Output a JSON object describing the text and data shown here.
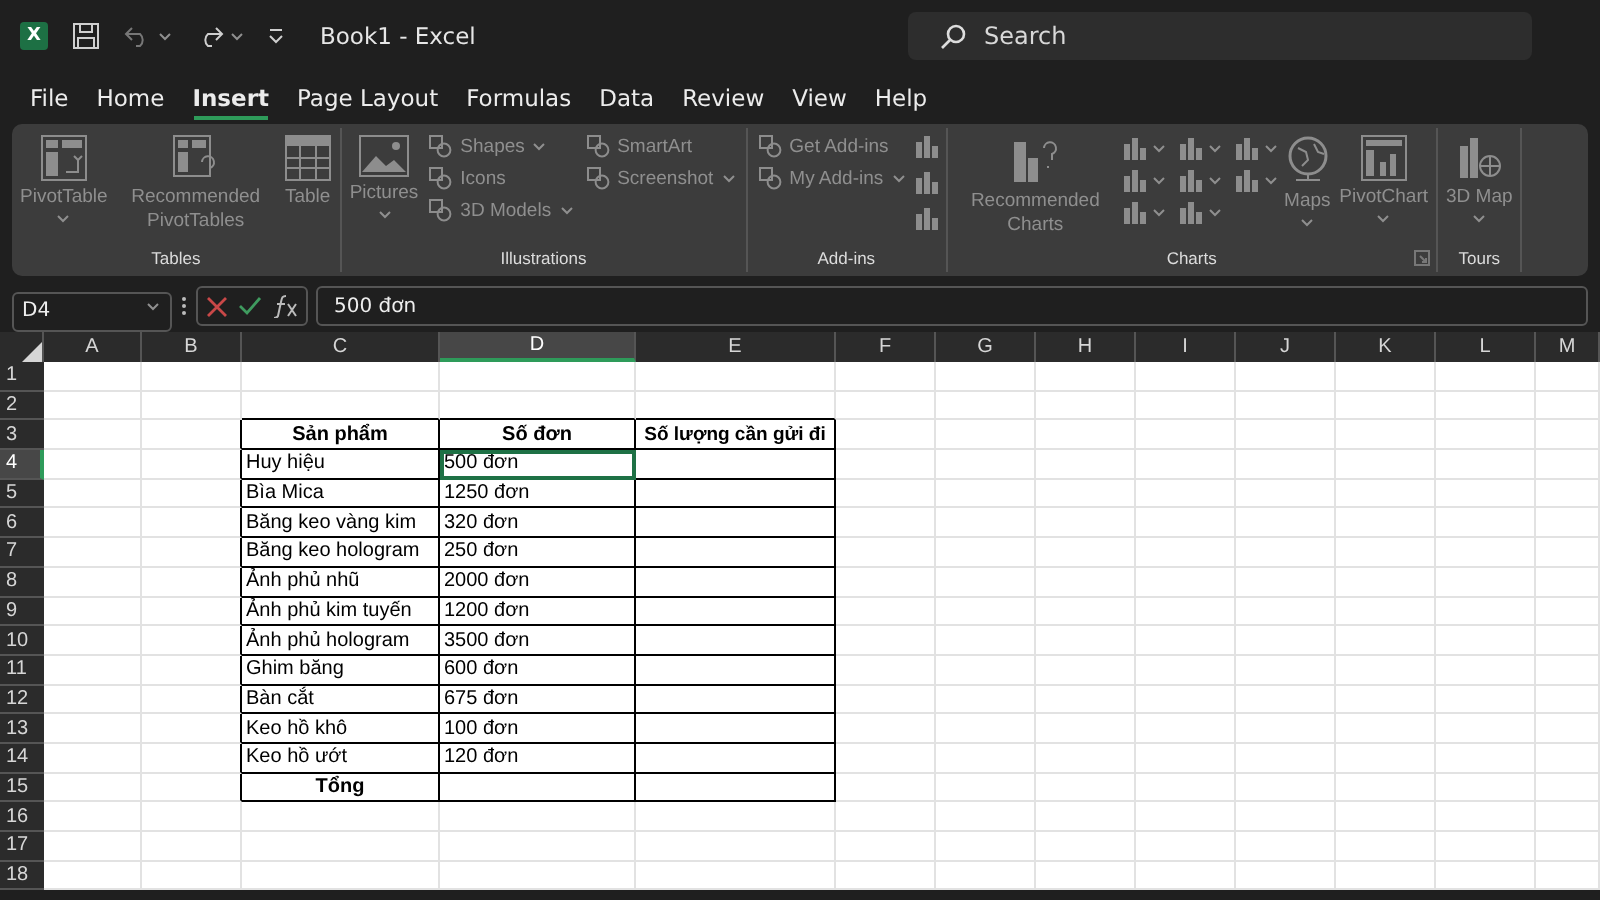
{
  "title_bar": {
    "logo_letter": "X",
    "title": "Book1  -  Excel",
    "search": {
      "placeholder": "Search"
    }
  },
  "menu_tabs": [
    {
      "label": "File",
      "selected": false
    },
    {
      "label": "Home",
      "selected": false
    },
    {
      "label": "Insert",
      "selected": true
    },
    {
      "label": "Page Layout",
      "selected": false
    },
    {
      "label": "Formulas",
      "selected": false
    },
    {
      "label": "Data",
      "selected": false
    },
    {
      "label": "Review",
      "selected": false
    },
    {
      "label": "View",
      "selected": false
    },
    {
      "label": "Help",
      "selected": false
    }
  ],
  "ribbon": {
    "groups": [
      {
        "label": "Tables",
        "items": [
          {
            "kind": "large",
            "label": "PivotTable",
            "dropdown": true
          },
          {
            "kind": "large",
            "label": "Recommended PivotTables",
            "dropdown": false
          },
          {
            "kind": "large",
            "label": "Table",
            "dropdown": false
          }
        ]
      },
      {
        "label": "Illustrations",
        "items": [
          {
            "kind": "large",
            "label": "Pictures",
            "dropdown": true
          },
          {
            "kind": "stack",
            "items": [
              {
                "label": "Shapes",
                "dropdown": true
              },
              {
                "label": "Icons",
                "dropdown": false
              },
              {
                "label": "3D Models",
                "dropdown": true
              }
            ]
          },
          {
            "kind": "stack",
            "items": [
              {
                "label": "SmartArt",
                "dropdown": false
              },
              {
                "label": "Screenshot",
                "dropdown": true
              }
            ]
          }
        ]
      },
      {
        "label": "Add-ins",
        "items": [
          {
            "kind": "stack",
            "items": [
              {
                "label": "Get Add-ins",
                "dropdown": false
              },
              {
                "label": "My Add-ins",
                "dropdown": true
              }
            ]
          },
          {
            "kind": "icon_column"
          }
        ]
      },
      {
        "label": "Charts",
        "items": [
          {
            "kind": "large",
            "label": "Recommended Charts",
            "dropdown": false
          },
          {
            "kind": "icon_grid"
          },
          {
            "kind": "large",
            "label": "Maps",
            "dropdown": true
          },
          {
            "kind": "large",
            "label": "PivotChart",
            "dropdown": true
          }
        ]
      },
      {
        "label": "Tours",
        "items": [
          {
            "kind": "large",
            "label": "3D Map",
            "dropdown": true
          }
        ]
      }
    ]
  },
  "formula_bar": {
    "name_box": "D4",
    "formula": "500 đơn"
  },
  "sheet": {
    "columns": [
      {
        "label": "A",
        "selected": false
      },
      {
        "label": "B",
        "selected": false
      },
      {
        "label": "C",
        "selected": false
      },
      {
        "label": "D",
        "selected": true
      },
      {
        "label": "E",
        "selected": false
      },
      {
        "label": "F",
        "selected": false
      },
      {
        "label": "G",
        "selected": false
      },
      {
        "label": "H",
        "selected": false
      },
      {
        "label": "I",
        "selected": false
      },
      {
        "label": "J",
        "selected": false
      },
      {
        "label": "K",
        "selected": false
      },
      {
        "label": "L",
        "selected": false
      },
      {
        "label": "M",
        "selected": false
      }
    ],
    "rows": [
      {
        "label": "1",
        "selected": false
      },
      {
        "label": "2",
        "selected": false
      },
      {
        "label": "3",
        "selected": false
      },
      {
        "label": "4",
        "selected": true
      },
      {
        "label": "5",
        "selected": false
      },
      {
        "label": "6",
        "selected": false
      },
      {
        "label": "7",
        "selected": false
      },
      {
        "label": "8",
        "selected": false
      },
      {
        "label": "9",
        "selected": false
      },
      {
        "label": "10",
        "selected": false
      },
      {
        "label": "11",
        "selected": false
      },
      {
        "label": "12",
        "selected": false
      },
      {
        "label": "13",
        "selected": false
      },
      {
        "label": "14",
        "selected": false
      },
      {
        "label": "15",
        "selected": false
      },
      {
        "label": "16",
        "selected": false
      },
      {
        "label": "17",
        "selected": false
      },
      {
        "label": "18",
        "selected": false
      }
    ],
    "table": {
      "header": [
        "Sản phẩm",
        "Số đơn",
        "Số lượng cần gửi đi"
      ],
      "rows": [
        {
          "product": "Huy hiệu",
          "orders": "500 đơn",
          "selected": true
        },
        {
          "product": "Bìa Mica",
          "orders": "1250 đơn",
          "selected": false
        },
        {
          "product": "Băng keo vàng kim",
          "orders": "320 đơn",
          "selected": false
        },
        {
          "product": "Băng keo hologram",
          "orders": "250 đơn",
          "selected": false
        },
        {
          "product": "Ảnh phủ nhũ",
          "orders": "2000 đơn",
          "selected": false
        },
        {
          "product": "Ảnh phủ kim tuyến",
          "orders": "1200 đơn",
          "selected": false
        },
        {
          "product": "Ảnh phủ hologram",
          "orders": "3500 đơn",
          "selected": false
        },
        {
          "product": "Ghim băng",
          "orders": "600 đơn",
          "selected": false
        },
        {
          "product": "Bàn cắt",
          "orders": "675 đơn",
          "selected": false
        },
        {
          "product": "Keo hồ khô",
          "orders": "100 đơn",
          "selected": false
        },
        {
          "product": "Keo hồ ướt",
          "orders": "120 đơn",
          "selected": false
        }
      ],
      "total_label": "Tổng"
    }
  }
}
